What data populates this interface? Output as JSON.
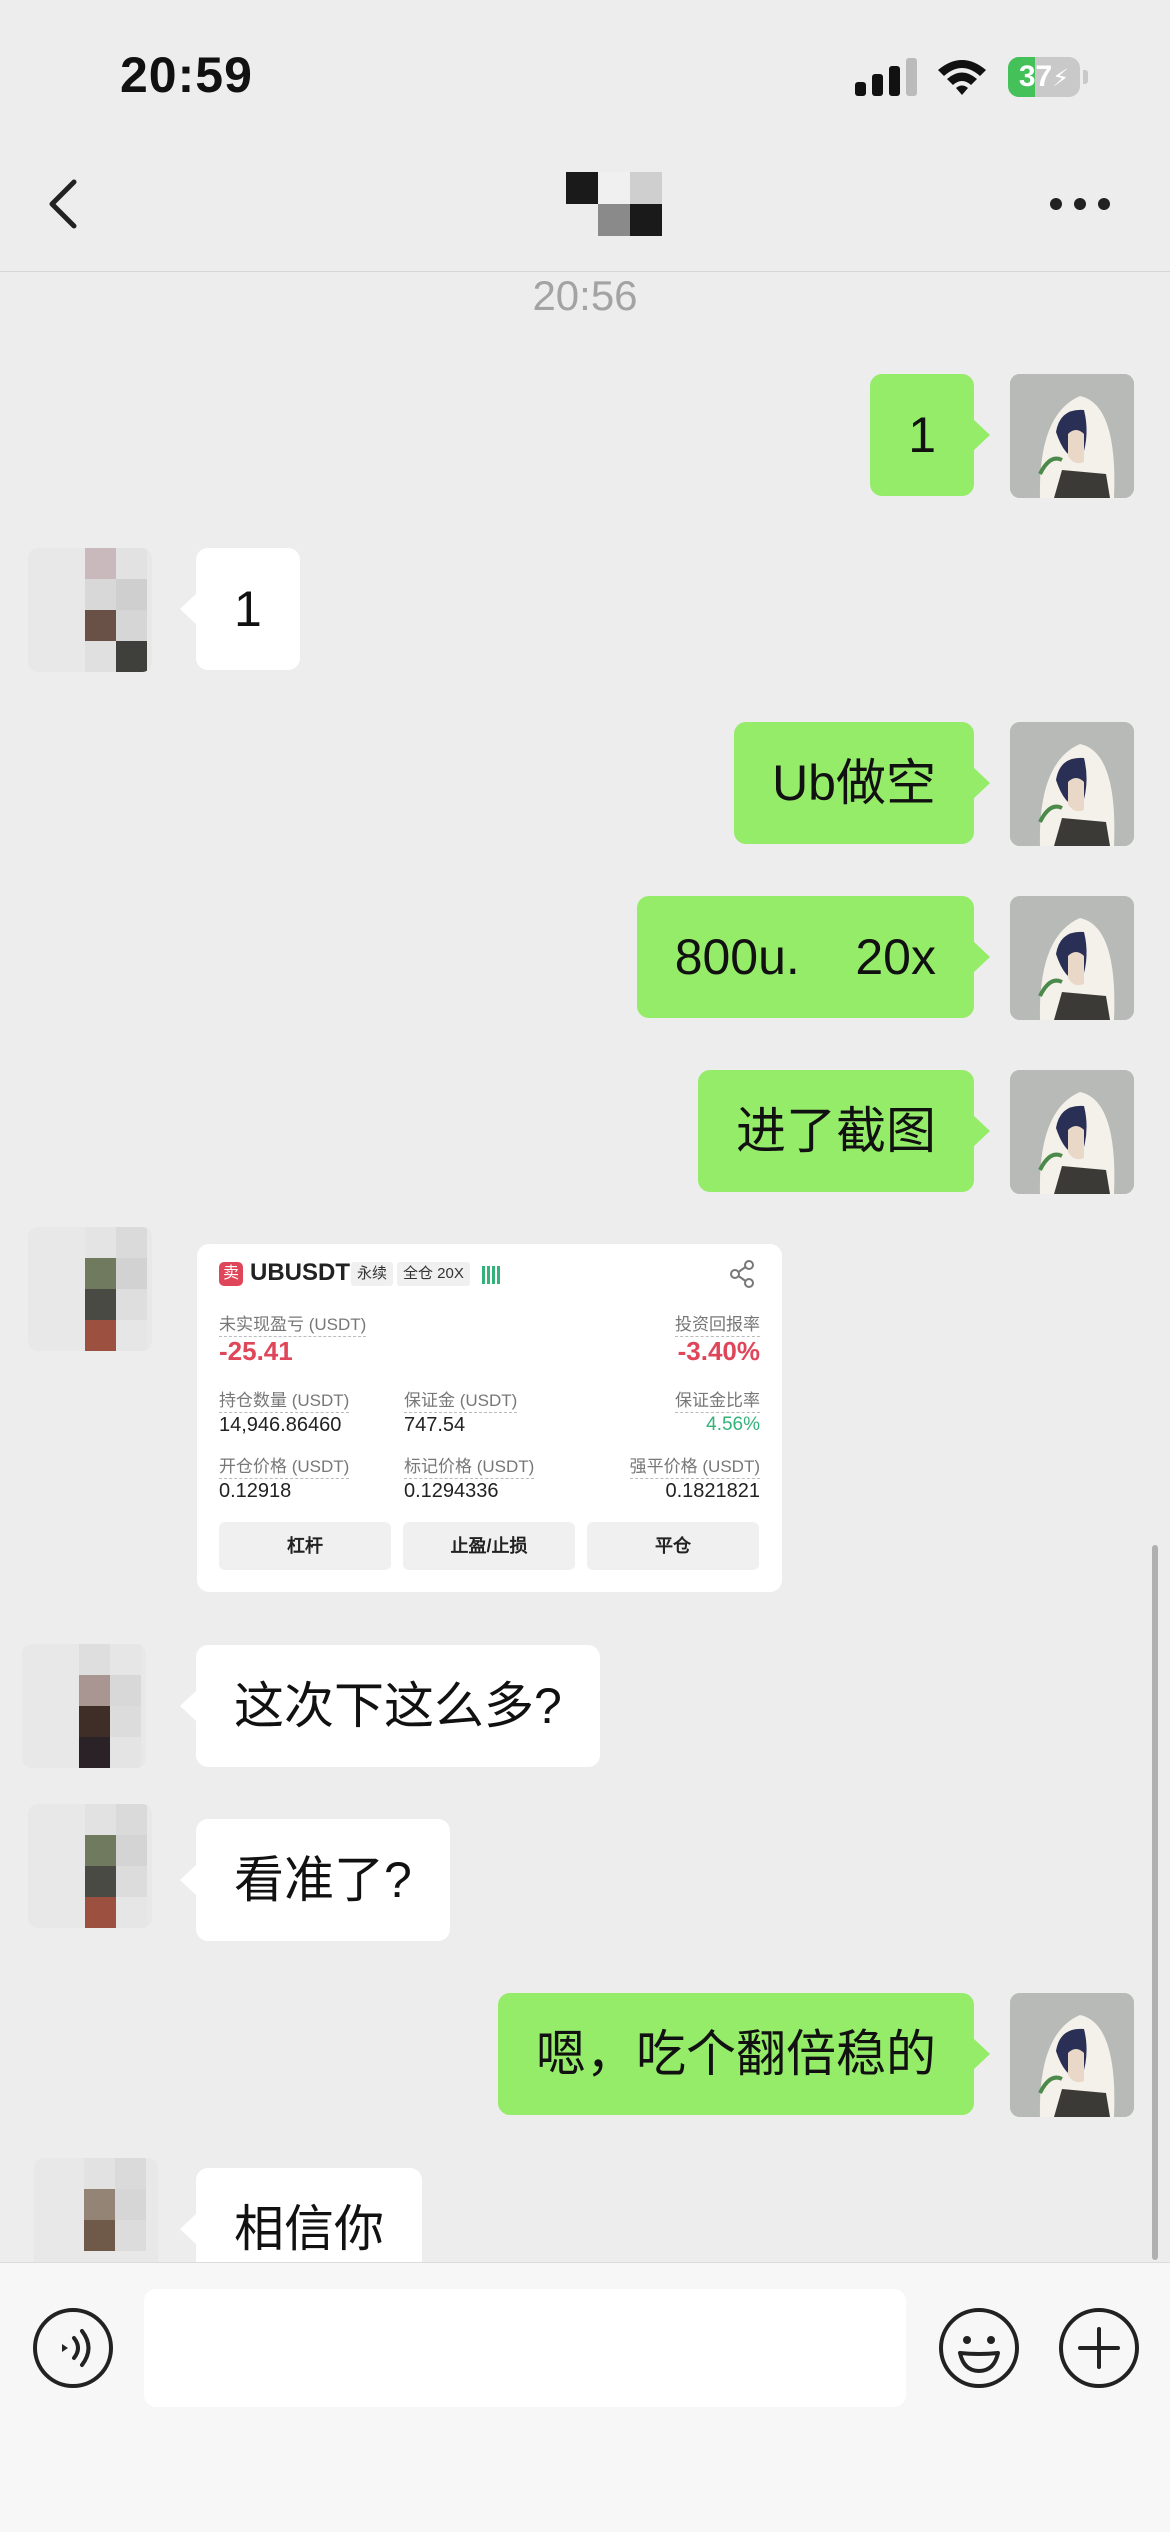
{
  "status_bar": {
    "time": "20:59",
    "battery_level": "37",
    "battery_fraction": 0.37,
    "icons": [
      "signal-icon",
      "wifi-icon",
      "battery-charging-icon"
    ]
  },
  "nav": {
    "back_icon": "chevron-left-icon",
    "title": "",
    "more_icon": "more-horizontal-icon"
  },
  "chat": {
    "time_divider": "20:56",
    "messages": [
      {
        "sender": "me",
        "text": "1"
      },
      {
        "sender": "peer",
        "text": "1"
      },
      {
        "sender": "me",
        "text": "Ub做空"
      },
      {
        "sender": "me",
        "text": "800u.    20x"
      },
      {
        "sender": "me",
        "text": "进了截图"
      },
      {
        "sender": "peer",
        "type": "image"
      },
      {
        "sender": "peer",
        "text": "这次下这么多?"
      },
      {
        "sender": "peer",
        "text": "看准了?"
      },
      {
        "sender": "me",
        "text": "嗯，吃个翻倍稳的"
      },
      {
        "sender": "peer",
        "text": "相信你"
      }
    ]
  },
  "position_card": {
    "sell_badge": "卖",
    "symbol": "UBUSDT",
    "tag_perpetual": "永续",
    "tag_leverage": "全仓 20X",
    "unrealized_pnl_label": "未实现盈亏 (USDT)",
    "unrealized_pnl_value": "-25.41",
    "roi_label": "投资回报率",
    "roi_value": "-3.40%",
    "position_size_label": "持仓数量 (USDT)",
    "position_size_value": "14,946.86460",
    "margin_label": "保证金 (USDT)",
    "margin_value": "747.54",
    "margin_ratio_label": "保证金比率",
    "margin_ratio_value": "4.56%",
    "entry_price_label": "开仓价格 (USDT)",
    "entry_price_value": "0.12918",
    "mark_price_label": "标记价格 (USDT)",
    "mark_price_value": "0.1294336",
    "liq_price_label": "强平价格 (USDT)",
    "liq_price_value": "0.1821821",
    "btn_leverage": "杠杆",
    "btn_tp_sl": "止盈/止损",
    "btn_close": "平仓"
  },
  "input_bar": {
    "placeholder": "",
    "icons": [
      "voice-icon",
      "emoji-icon",
      "plus-icon"
    ]
  },
  "colors": {
    "background": "#ededed",
    "my_bubble": "#95ec69",
    "peer_bubble": "#ffffff",
    "loss_red": "#e0465a",
    "profit_green": "#34b27a"
  }
}
